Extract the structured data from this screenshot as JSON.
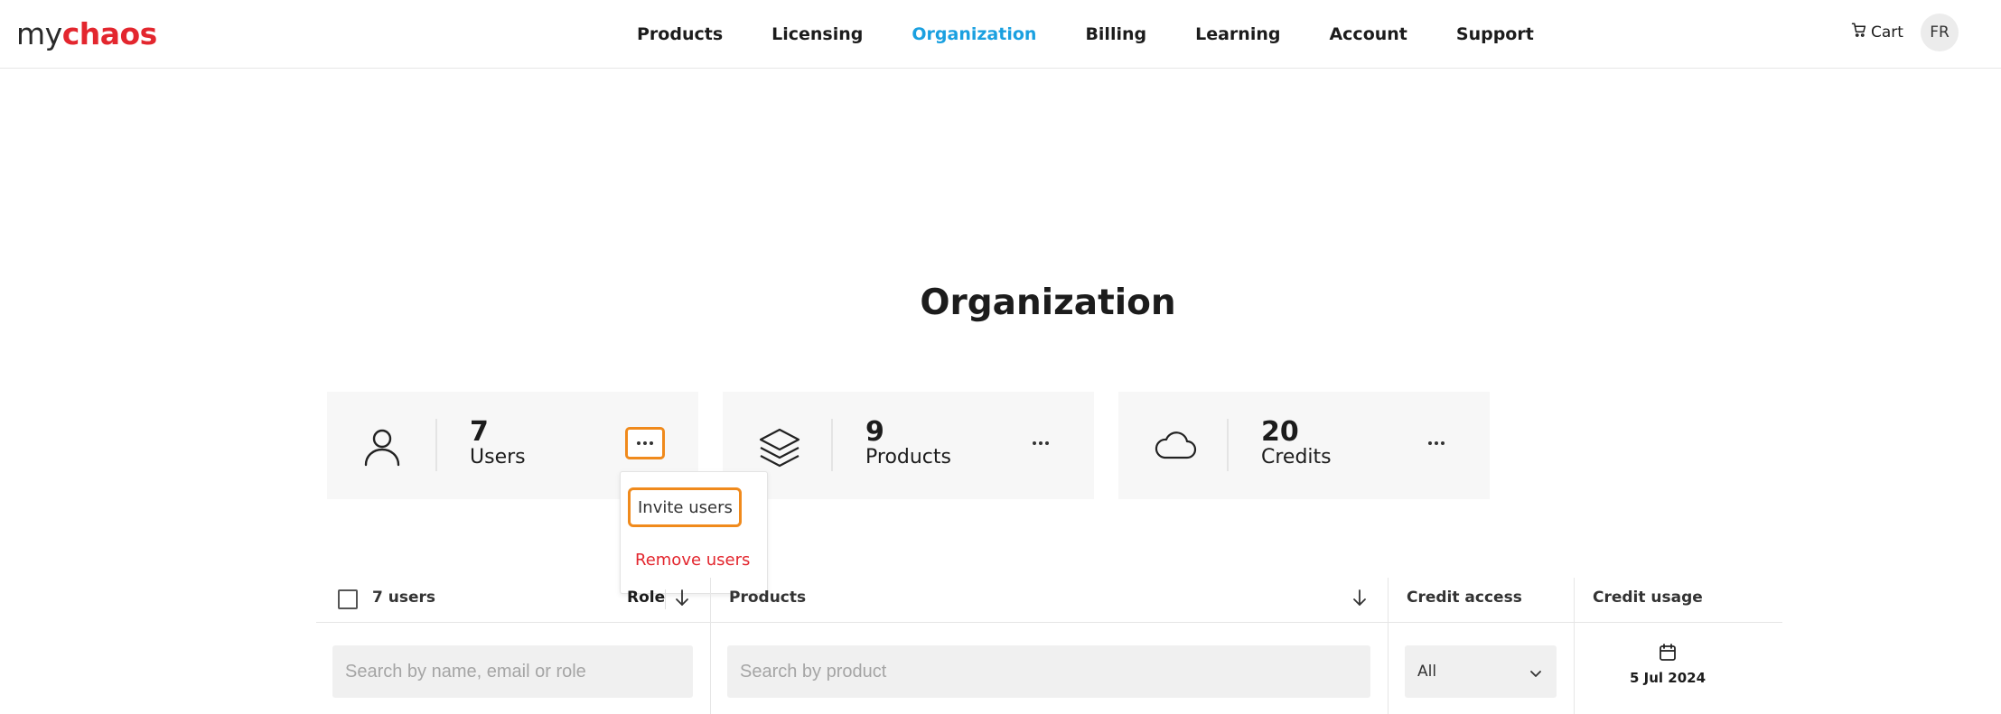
{
  "header": {
    "logo_my": "my",
    "logo_chaos": "chaos",
    "nav": [
      "Products",
      "Licensing",
      "Organization",
      "Billing",
      "Learning",
      "Account",
      "Support"
    ],
    "active_nav": "Organization",
    "cart_label": "Cart",
    "avatar_initials": "FR"
  },
  "page_title": "Organization",
  "cards": [
    {
      "count": "7",
      "label": "Users",
      "icon": "user-icon"
    },
    {
      "count": "9",
      "label": "Products",
      "icon": "layers-icon"
    },
    {
      "count": "20",
      "label": "Credits",
      "icon": "cloud-icon"
    }
  ],
  "dropdown": {
    "invite_label": "Invite users",
    "remove_label": "Remove users"
  },
  "table": {
    "users_count_label": "7 users",
    "role_label": "Role",
    "products_label": "Products",
    "credit_access_label": "Credit access",
    "credit_usage_label": "Credit usage"
  },
  "filters": {
    "search_placeholder": "Search by name, email or role",
    "product_placeholder": "Search by product",
    "credit_access_value": "All",
    "date_value": "5 Jul 2024"
  },
  "colors": {
    "accent": "#1aa0e0",
    "brand_red": "#e3262e",
    "highlight": "#f08a1c"
  }
}
